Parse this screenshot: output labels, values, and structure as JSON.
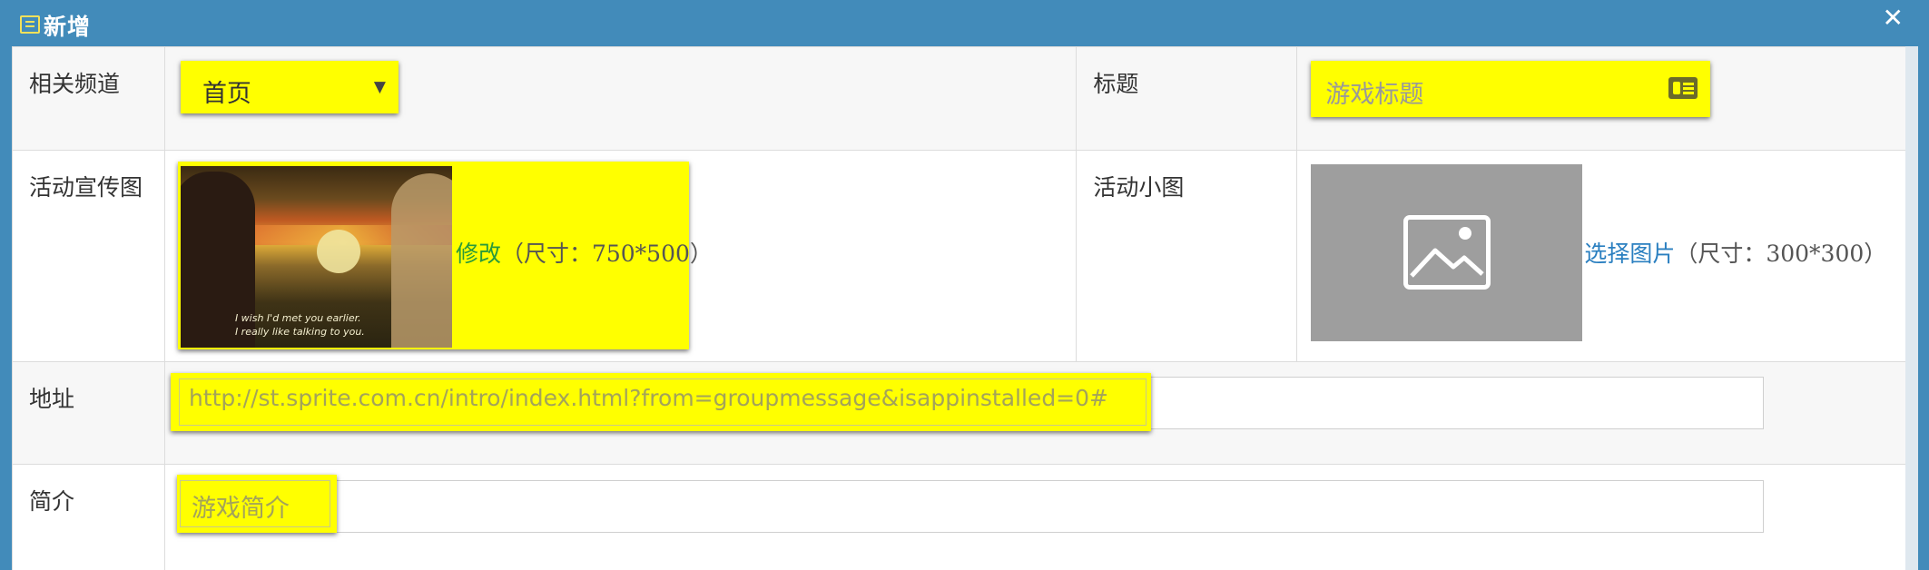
{
  "dialog": {
    "title": "新增",
    "close_label": "✕"
  },
  "fields": {
    "channel": {
      "label": "相关频道",
      "value": "首页"
    },
    "title": {
      "label": "标题",
      "placeholder": "游戏标题"
    },
    "promo_image": {
      "label": "活动宣传图",
      "action": "修改",
      "size_hint": "（尺寸：750*500）",
      "subtitle_line1": "I wish I'd met you earlier.",
      "subtitle_line2": "I really like talking to you."
    },
    "small_image": {
      "label": "活动小图",
      "action": "选择图片",
      "size_hint": "（尺寸：300*300）"
    },
    "address": {
      "label": "地址",
      "value": "http://st.sprite.com.cn/intro/index.html?from=groupmessage&isappinstalled=0#"
    },
    "intro": {
      "label": "简介",
      "placeholder": "游戏简介"
    }
  },
  "colors": {
    "titlebar": "#428bba",
    "highlight": "#ffff00",
    "link_green": "#2a9a3a",
    "link_blue": "#2a7fc0"
  }
}
